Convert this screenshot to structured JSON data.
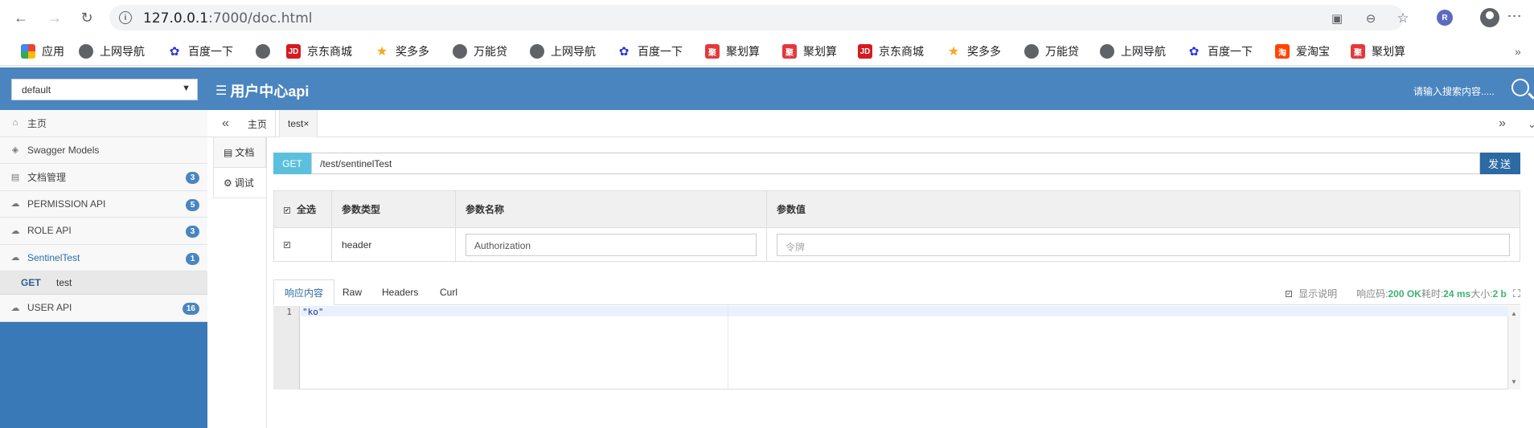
{
  "browser": {
    "url_host": "127.0.0.1",
    "url_rest": ":7000/doc.html",
    "ext_badge": "R",
    "bookmarks": [
      {
        "label": "应用",
        "icon": "apps-grid-icon",
        "color": "#4285f4"
      },
      {
        "label": "上网导航",
        "icon": "globe-icon",
        "color": "#5f6368"
      },
      {
        "label": "百度一下",
        "icon": "baidu-paw-icon",
        "color": "#2932e1"
      },
      {
        "label": "",
        "icon": "globe-icon",
        "color": "#5f6368"
      },
      {
        "label": "京东商城",
        "icon": "jd-icon",
        "color": "#d71920"
      },
      {
        "label": "奖多多",
        "icon": "star-icon",
        "color": "#f6a623"
      },
      {
        "label": "万能贷",
        "icon": "globe-icon",
        "color": "#5f6368"
      },
      {
        "label": "上网导航",
        "icon": "globe-icon",
        "color": "#5f6368"
      },
      {
        "label": "百度一下",
        "icon": "baidu-paw-icon",
        "color": "#2932e1"
      },
      {
        "label": "聚划算",
        "icon": "juhuasuan-icon",
        "color": "#e4393c"
      },
      {
        "label": "聚划算",
        "icon": "juhuasuan-icon",
        "color": "#e4393c"
      },
      {
        "label": "京东商城",
        "icon": "jd-icon",
        "color": "#d71920"
      },
      {
        "label": "奖多多",
        "icon": "star-icon",
        "color": "#f6a623"
      },
      {
        "label": "万能贷",
        "icon": "globe-icon",
        "color": "#5f6368"
      },
      {
        "label": "上网导航",
        "icon": "globe-icon",
        "color": "#5f6368"
      },
      {
        "label": "百度一下",
        "icon": "baidu-paw-icon",
        "color": "#2932e1"
      },
      {
        "label": "爱淘宝",
        "icon": "taobao-icon",
        "color": "#ff4400"
      },
      {
        "label": "聚划算",
        "icon": "juhuasuan-icon",
        "color": "#e4393c"
      }
    ],
    "bookmark_glyphs": {
      "jd-icon": "JD",
      "juhuasuan-icon": "聚",
      "taobao-icon": "淘"
    },
    "bookmarks_more": "»"
  },
  "header": {
    "group_select": "default",
    "title": "用户中心api",
    "search_placeholder": "请输入搜索内容.....",
    "accent": "#4a85bf"
  },
  "sidebar": {
    "items": [
      {
        "label": "主页",
        "icon": "home-icon",
        "glyph": "⌂",
        "badge": ""
      },
      {
        "label": "Swagger Models",
        "icon": "cube-icon",
        "glyph": "◈",
        "badge": ""
      },
      {
        "label": "文档管理",
        "icon": "folder-icon",
        "glyph": "▤",
        "badge": "3"
      },
      {
        "label": "PERMISSION API",
        "icon": "cloud-icon",
        "glyph": "☁",
        "badge": "5"
      },
      {
        "label": "ROLE API",
        "icon": "cloud-icon",
        "glyph": "☁",
        "badge": "3"
      },
      {
        "label": "SentinelTest",
        "icon": "cloud-icon",
        "glyph": "☁",
        "badge": "1",
        "active": true
      },
      {
        "label": "USER API",
        "icon": "cloud-icon",
        "glyph": "☁",
        "badge": "16"
      }
    ],
    "sub_item": {
      "method": "GET",
      "label": "test"
    }
  },
  "tabs": {
    "collapse_left": "«",
    "collapse_right": "»",
    "items": [
      {
        "label": "主页"
      },
      {
        "label": "test",
        "close": "×"
      }
    ]
  },
  "vtabs": {
    "doc": "文档",
    "debug": "调试"
  },
  "request": {
    "method": "GET",
    "path": "/test/sentinelTest",
    "send": "发送"
  },
  "params_table": {
    "headers": {
      "select_all": "全选",
      "type": "参数类型",
      "name": "参数名称",
      "value": "参数值"
    },
    "rows": [
      {
        "type": "header",
        "name": "Authorization",
        "value_placeholder": "令牌"
      }
    ]
  },
  "response": {
    "tabs": [
      "响应内容",
      "Raw",
      "Headers",
      "Curl"
    ],
    "show_desc": "显示说明",
    "code_label": "响应码:",
    "code_value": "200 OK",
    "time_label": "耗时:",
    "time_value": "24 ms",
    "size_label": "大小:",
    "size_value": "2 b",
    "expand": "⛶",
    "line_number": "1",
    "body": "\"ko\""
  }
}
